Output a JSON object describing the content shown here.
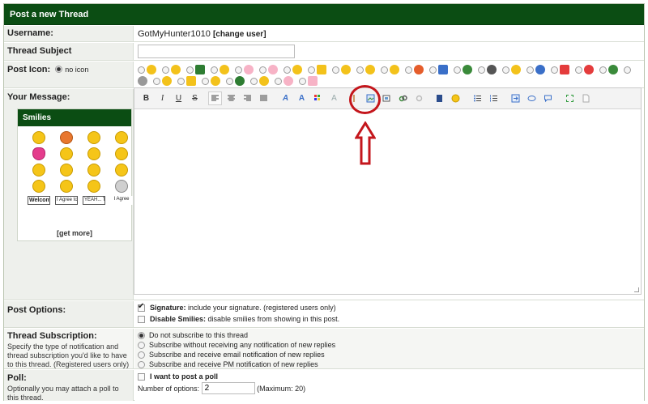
{
  "header": {
    "title": "Post a new Thread"
  },
  "username": {
    "label": "Username:",
    "value": "GotMyHunter1010",
    "change_link": "[change user]"
  },
  "subject": {
    "label": "Thread Subject",
    "value": ""
  },
  "post_icon": {
    "label": "Post Icon:",
    "no_icon_label": "no icon",
    "icon_count": 28
  },
  "message": {
    "label": "Your Message:"
  },
  "toolbar": {
    "bold": "B",
    "italic": "I",
    "underline": "U",
    "strike": "S"
  },
  "smilies": {
    "title": "Smilies",
    "sign_agree": "I Agree to Disagree",
    "sign_welcome": "Welcome!",
    "sign_yeah": "YEAH... THAT",
    "sign_i_agree": "I Agree",
    "get_more": "[get more]"
  },
  "post_options": {
    "label": "Post Options:",
    "signature_bold": "Signature:",
    "signature_text": "include your signature. (registered users only)",
    "smilies_bold": "Disable Smilies:",
    "smilies_text": "disable smilies from showing in this post."
  },
  "subscription": {
    "label": "Thread Subscription:",
    "description": "Specify the type of notification and thread subscription you'd like to have to this thread. (Registered users only)",
    "options": [
      "Do not subscribe to this thread",
      "Subscribe without receiving any notification of new replies",
      "Subscribe and receive email notification of new replies",
      "Subscribe and receive PM notification of new replies"
    ]
  },
  "poll": {
    "label": "Poll:",
    "description": "Optionally you may attach a poll to this thread.",
    "checkbox_label": "I want to post a poll",
    "options_label": "Number of options:",
    "options_value": "2",
    "max_label": "(Maximum: 20)"
  },
  "colors": {
    "header_bg": "#0b4d13",
    "annotation": "#c4161c"
  }
}
